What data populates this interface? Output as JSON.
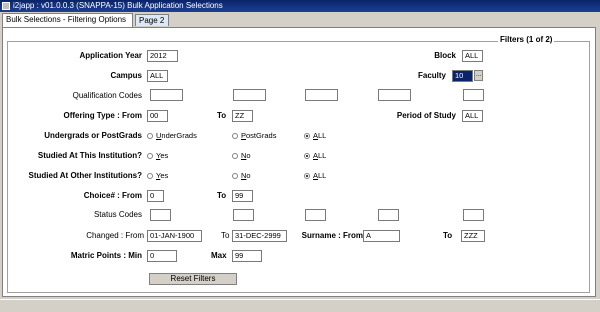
{
  "window": {
    "title": "i2japp : v01.0.0.3 (SNAPPA-15) Bulk Application Selections"
  },
  "tabs": [
    {
      "label": "Bulk Selections - Filtering Options"
    },
    {
      "label": "Page 2"
    }
  ],
  "form": {
    "group_title": "Filters (1 of 2)",
    "application_year": {
      "label": "Application Year",
      "value": "2012"
    },
    "block": {
      "label": "Block",
      "value": "ALL"
    },
    "campus": {
      "label": "Campus",
      "value": "ALL"
    },
    "faculty": {
      "label": "Faculty",
      "value": "10",
      "lov": "..."
    },
    "qualification_codes": {
      "label": "Qualification Codes",
      "values": [
        "",
        "",
        "",
        "",
        ""
      ]
    },
    "offering_type": {
      "label": "Offering Type : From",
      "from": "00",
      "to_label": "To",
      "to": "ZZ"
    },
    "period_of_study": {
      "label": "Period of Study",
      "value": "ALL"
    },
    "undergrads_postgrads": {
      "label": "Undergrads or PostGrads",
      "options": [
        {
          "first": "U",
          "rest": "nderGrads"
        },
        {
          "first": "P",
          "rest": "ostGrads"
        },
        {
          "first": "A",
          "rest": "LL"
        }
      ],
      "selected": 2
    },
    "studied_this": {
      "label": "Studied At This Institution?",
      "options": [
        {
          "first": "Y",
          "rest": "es"
        },
        {
          "first": "N",
          "rest": "o"
        },
        {
          "first": "A",
          "rest": "LL"
        }
      ],
      "selected": 2
    },
    "studied_other": {
      "label": "Studied At Other Institutions?",
      "options": [
        {
          "first": "Y",
          "rest": "es"
        },
        {
          "first": "N",
          "rest": "o"
        },
        {
          "first": "A",
          "rest": "LL"
        }
      ],
      "selected": 2
    },
    "choice": {
      "label": "Choice# : From",
      "from": "0",
      "to_label": "To",
      "to": "99"
    },
    "status_codes": {
      "label": "Status Codes",
      "values": [
        "",
        "",
        "",
        "",
        ""
      ]
    },
    "changed": {
      "label": "Changed : From",
      "from": "01-JAN-1900",
      "to_label": "To",
      "to": "31-DEC-2999"
    },
    "surname": {
      "label": "Surname : From",
      "from": "A",
      "to_label": "To",
      "to": "ZZZ"
    },
    "matric_points": {
      "label": "Matric Points : Min",
      "min": "0",
      "max_label": "Max",
      "max": "99"
    },
    "reset_button": "Reset Filters"
  }
}
